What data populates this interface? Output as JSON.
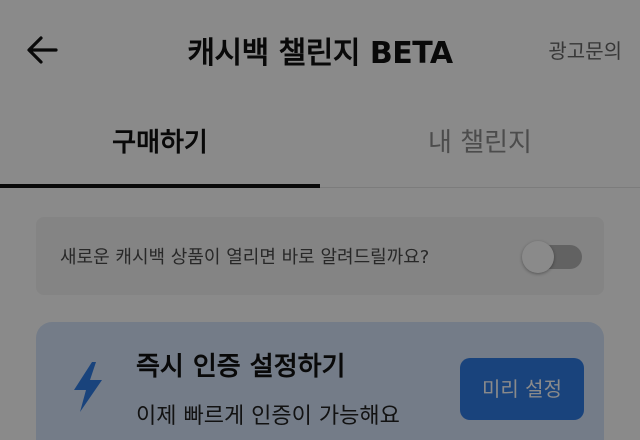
{
  "header": {
    "title": "캐시백 챌린지 BETA",
    "ad_inquiry": "광고문의"
  },
  "tabs": [
    {
      "label": "구매하기",
      "active": true
    },
    {
      "label": "내 챌린지",
      "active": false
    }
  ],
  "notification": {
    "text": "새로운 캐시백 상품이 열리면 바로 알려드릴까요?",
    "toggle_on": false
  },
  "instant_verification": {
    "title": "즉시 인증 설정하기",
    "subtitle": "이제 빠르게 인증이 가능해요",
    "button_label": "미리 설정",
    "icon": "lightning-bolt-icon"
  },
  "colors": {
    "accent": "#2f7ce6",
    "card_bg": "#d7e6fb",
    "overlay": "rgba(0,0,0,0.46)"
  }
}
